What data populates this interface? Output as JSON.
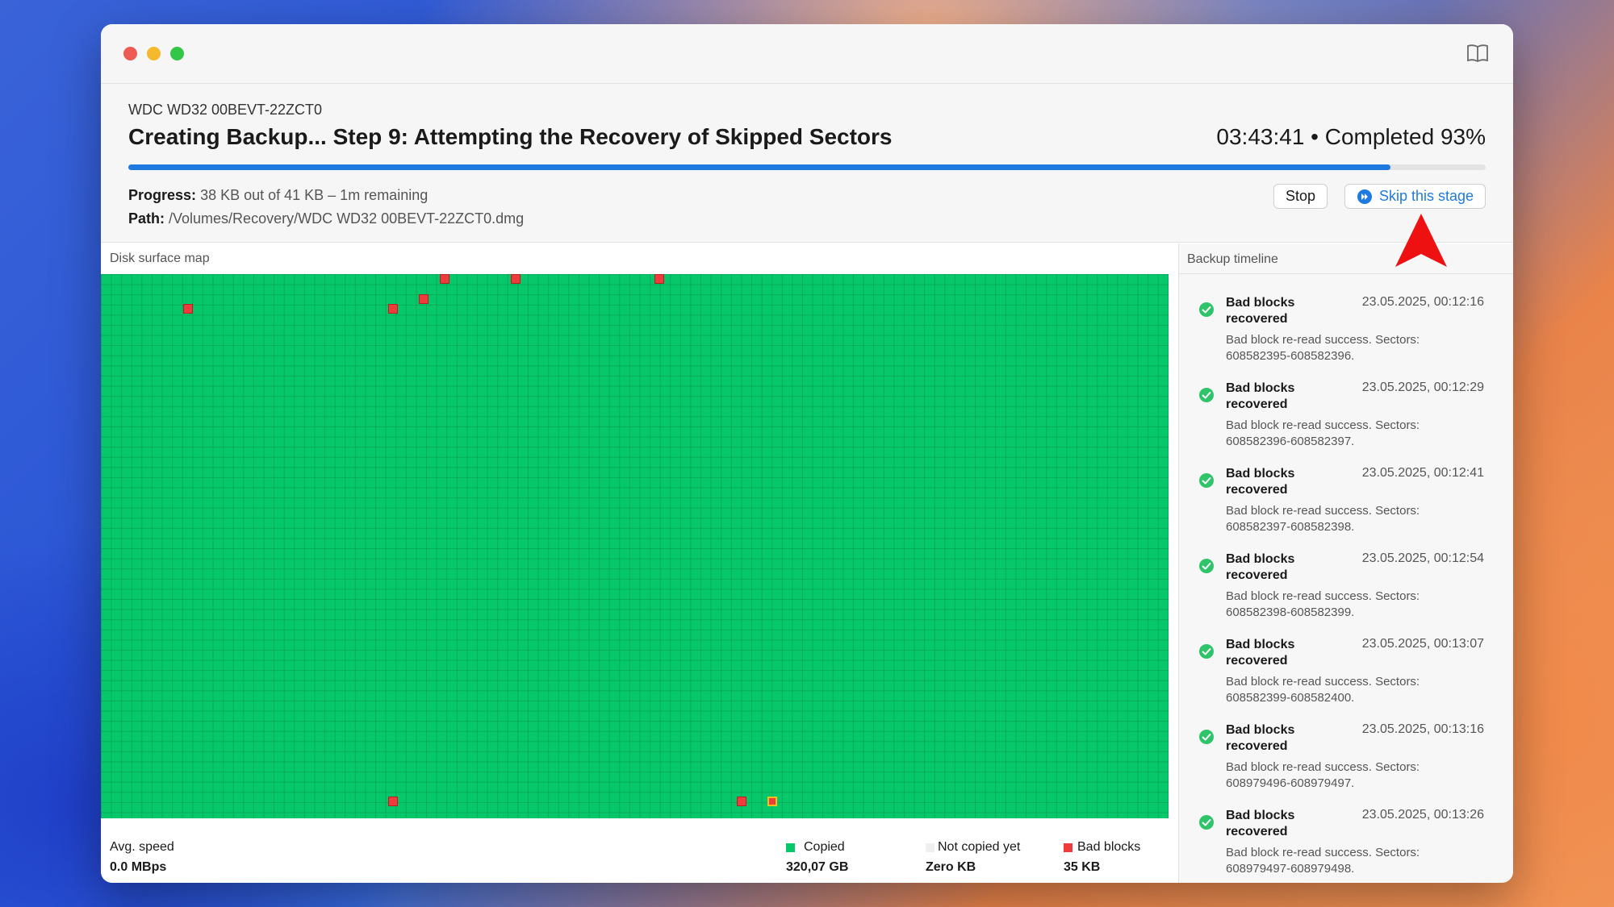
{
  "window": {
    "device": "WDC WD32 00BEVT-22ZCT0",
    "title": "Creating Backup... Step 9: Attempting the Recovery of Skipped Sectors",
    "completed": "03:43:41 • Completed 93%",
    "progress_fraction": 0.93,
    "progress_label": "Progress:",
    "progress_value": "38 KB out of 41 KB – 1m remaining",
    "path_label": "Path:",
    "path_value": "/Volumes/Recovery/WDC WD32 00BEVT-22ZCT0.dmg",
    "stop_label": "Stop",
    "skip_label": "Skip this stage"
  },
  "map": {
    "label": "Disk surface map",
    "avg_speed_label": "Avg. speed",
    "avg_speed_value": "0.0 MBps",
    "legend": [
      {
        "label": "Copied",
        "value": "320,07 GB",
        "color": "#06c76a"
      },
      {
        "label": "Not copied yet",
        "value": "Zero KB",
        "color": "#efefef"
      },
      {
        "label": "Bad blocks",
        "value": "35 KB",
        "color": "#ee3b3b"
      }
    ]
  },
  "timeline": {
    "label": "Backup timeline",
    "items": [
      {
        "title": "Bad blocks recovered",
        "time": "23.05.2025, 00:12:16",
        "desc": "Bad block re-read success. Sectors: 608582395-608582396."
      },
      {
        "title": "Bad blocks recovered",
        "time": "23.05.2025, 00:12:29",
        "desc": "Bad block re-read success. Sectors: 608582396-608582397."
      },
      {
        "title": "Bad blocks recovered",
        "time": "23.05.2025, 00:12:41",
        "desc": "Bad block re-read success. Sectors: 608582397-608582398."
      },
      {
        "title": "Bad blocks recovered",
        "time": "23.05.2025, 00:12:54",
        "desc": "Bad block re-read success. Sectors: 608582398-608582399."
      },
      {
        "title": "Bad blocks recovered",
        "time": "23.05.2025, 00:13:07",
        "desc": "Bad block re-read success. Sectors: 608582399-608582400."
      },
      {
        "title": "Bad blocks recovered",
        "time": "23.05.2025, 00:13:16",
        "desc": "Bad block re-read success. Sectors: 608979496-608979497."
      },
      {
        "title": "Bad blocks recovered",
        "time": "23.05.2025, 00:13:26",
        "desc": "Bad block re-read success. Sectors: 608979497-608979498."
      }
    ]
  },
  "icons": {
    "close": "close-icon",
    "minimize": "minimize-icon",
    "zoom": "zoom-icon",
    "book": "book-icon",
    "skip": "skip-forward-icon",
    "check": "check-circle-icon",
    "arrow": "red-arrow-annotation"
  }
}
